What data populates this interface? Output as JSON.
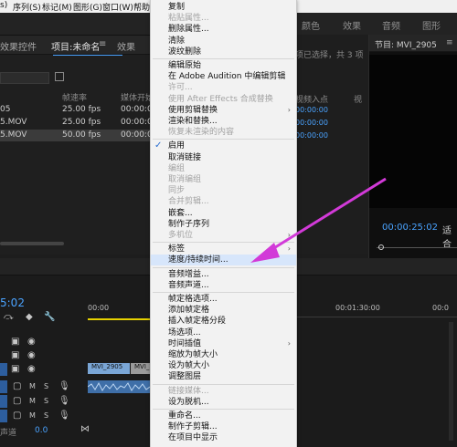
{
  "menubar": {
    "items": [
      "s)",
      "序列(S)",
      "标记(M)",
      "图形(G)",
      "窗口(W)",
      "帮助"
    ]
  },
  "topbar": {
    "tabs": [
      "颜色",
      "效果",
      "音频",
      "图形"
    ]
  },
  "project_panel": {
    "tabs": [
      "效果控件",
      "项目:未命名",
      "效果"
    ],
    "menu_glyph": "≡",
    "columns": [
      "帧速率",
      "媒体开始"
    ],
    "rows": [
      {
        "name": "05",
        "fps": "25.00 fps",
        "start": "00:00:00"
      },
      {
        "name": "5.MOV",
        "fps": "25.00 fps",
        "start": "00:00:00"
      },
      {
        "name": "5.MOV",
        "fps": "50.00 fps",
        "start": "00:00:00"
      }
    ]
  },
  "right_panel": {
    "status_text": "项已选择，共 3 项",
    "column": "视频入点",
    "col2": "视",
    "cells": [
      "00:00:00",
      "00:00:00",
      "00:00:00"
    ],
    "program_tab": "节目: MVI_2905",
    "menu_glyph": "≡",
    "timecode": "00:00:25:02",
    "fit_label": "适合"
  },
  "timeline": {
    "timecode": "5:02",
    "ruler": [
      "00:00",
      "00:01:30:00",
      "00:0"
    ],
    "clip_labels": [
      "MVI_2905",
      "MVI_2905"
    ],
    "tracks": [
      "V3",
      "V2",
      "V1",
      "A1",
      "A2",
      "A3"
    ],
    "bottom_label": "声道",
    "bottom_value": "0.0"
  },
  "context_menu": {
    "items": [
      {
        "label": "复制",
        "enabled": true
      },
      {
        "label": "粘贴属性...",
        "enabled": false
      },
      {
        "label": "删除属性...",
        "enabled": true
      },
      {
        "label": "清除",
        "enabled": true
      },
      {
        "label": "波纹删除",
        "enabled": true
      },
      {
        "label": "编辑原始",
        "enabled": true
      },
      {
        "label": "在 Adobe Audition 中编辑剪辑",
        "enabled": true
      },
      {
        "label": "许可...",
        "enabled": false
      },
      {
        "label": "使用 After Effects 合成替换",
        "enabled": false
      },
      {
        "label": "使用剪辑替换",
        "enabled": true,
        "submenu": true
      },
      {
        "label": "渲染和替换...",
        "enabled": true
      },
      {
        "label": "恢复未渲染的内容",
        "enabled": false
      },
      {
        "label": "启用",
        "enabled": true,
        "checked": true
      },
      {
        "label": "取消链接",
        "enabled": true
      },
      {
        "label": "编组",
        "enabled": false
      },
      {
        "label": "取消编组",
        "enabled": false
      },
      {
        "label": "同步",
        "enabled": false
      },
      {
        "label": "合并剪辑...",
        "enabled": false
      },
      {
        "label": "嵌套...",
        "enabled": true
      },
      {
        "label": "制作子序列",
        "enabled": true
      },
      {
        "label": "多机位",
        "enabled": false,
        "submenu": true
      },
      {
        "label": "标签",
        "enabled": true,
        "submenu": true
      },
      {
        "label": "速度/持续时间...",
        "enabled": true,
        "highlight": true
      },
      {
        "label": "音频增益...",
        "enabled": true
      },
      {
        "label": "音频声道...",
        "enabled": true
      },
      {
        "label": "帧定格选项...",
        "enabled": true
      },
      {
        "label": "添加帧定格",
        "enabled": true
      },
      {
        "label": "插入帧定格分段",
        "enabled": true
      },
      {
        "label": "场选项...",
        "enabled": true
      },
      {
        "label": "时间插值",
        "enabled": true,
        "submenu": true
      },
      {
        "label": "缩放为帧大小",
        "enabled": true
      },
      {
        "label": "设为帧大小",
        "enabled": true
      },
      {
        "label": "调整图层",
        "enabled": true
      },
      {
        "label": "链接媒体...",
        "enabled": false
      },
      {
        "label": "设为脱机...",
        "enabled": true
      },
      {
        "label": "重命名...",
        "enabled": true
      },
      {
        "label": "制作子剪辑...",
        "enabled": true
      },
      {
        "label": "在项目中显示",
        "enabled": true
      }
    ]
  },
  "colors": {
    "accent_blue": "#4aa3ff",
    "arrow_magenta": "#d23ad8",
    "clip_blue": "#7aa6d6"
  }
}
